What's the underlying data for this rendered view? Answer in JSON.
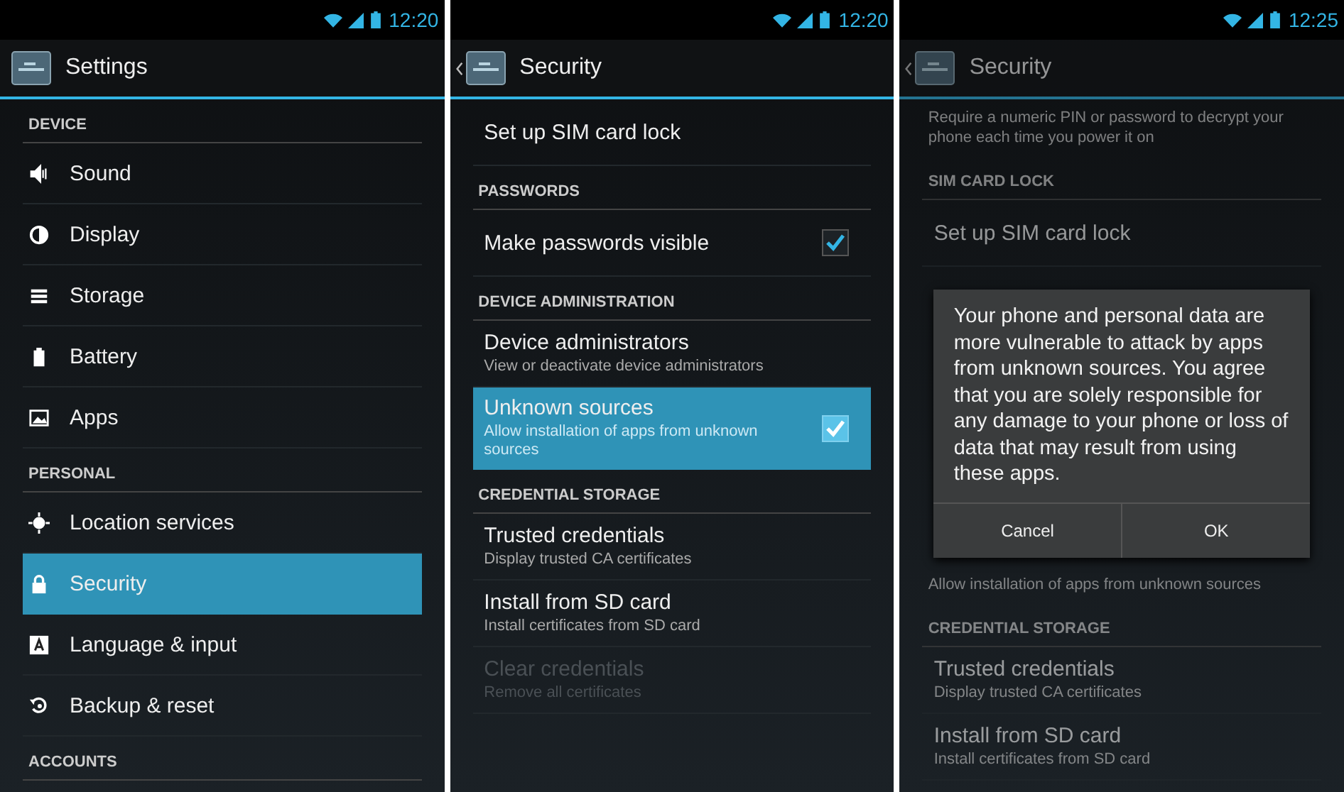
{
  "screens": [
    {
      "status_bar": {
        "time": "12:20"
      },
      "title": "Settings",
      "back": false,
      "dimmed": false,
      "list": [
        {
          "kind": "header",
          "label": "DEVICE"
        },
        {
          "kind": "nav",
          "label": "Sound",
          "selected": false
        },
        {
          "kind": "nav",
          "label": "Display",
          "selected": false
        },
        {
          "kind": "nav",
          "label": "Storage",
          "selected": false
        },
        {
          "kind": "nav",
          "label": "Battery",
          "selected": false
        },
        {
          "kind": "nav",
          "label": "Apps",
          "selected": false
        },
        {
          "kind": "header",
          "label": "PERSONAL"
        },
        {
          "kind": "nav",
          "label": "Location services",
          "selected": false
        },
        {
          "kind": "nav",
          "label": "Security",
          "selected": true
        },
        {
          "kind": "nav",
          "label": "Language & input",
          "selected": false
        },
        {
          "kind": "nav",
          "label": "Backup & reset",
          "selected": false
        },
        {
          "kind": "header",
          "label": "ACCOUNTS"
        }
      ]
    },
    {
      "status_bar": {
        "time": "12:20"
      },
      "title": "Security",
      "back": true,
      "dimmed": false,
      "list": [
        {
          "kind": "pref",
          "label": "Set up SIM card lock",
          "selected": false,
          "disabled": false
        },
        {
          "kind": "header",
          "label": "PASSWORDS"
        },
        {
          "kind": "pref",
          "label": "Make passwords visible",
          "checked": true,
          "selected": false,
          "disabled": false
        },
        {
          "kind": "header",
          "label": "DEVICE ADMINISTRATION"
        },
        {
          "kind": "pref",
          "label": "Device administrators",
          "summary": "View or deactivate device administrators",
          "selected": false,
          "disabled": false
        },
        {
          "kind": "pref",
          "label": "Unknown sources",
          "summary": "Allow installation of apps from unknown sources",
          "checked": true,
          "selected": true,
          "disabled": false
        },
        {
          "kind": "header",
          "label": "CREDENTIAL STORAGE"
        },
        {
          "kind": "pref",
          "label": "Trusted credentials",
          "summary": "Display trusted CA certificates",
          "selected": false,
          "disabled": false
        },
        {
          "kind": "pref",
          "label": "Install from SD card",
          "summary": "Install certificates from SD card",
          "selected": false,
          "disabled": false
        },
        {
          "kind": "pref",
          "label": "Clear credentials",
          "summary": "Remove all certificates",
          "selected": false,
          "disabled": true
        }
      ]
    },
    {
      "status_bar": {
        "time": "12:25"
      },
      "title": "Security",
      "back": true,
      "dimmed": true,
      "list": [
        {
          "kind": "note",
          "label": "Require a numeric PIN or password to decrypt your phone each time you power it on"
        },
        {
          "kind": "header",
          "label": "SIM CARD LOCK"
        },
        {
          "kind": "pref",
          "label": "Set up SIM card lock",
          "selected": false,
          "disabled": false
        }
      ],
      "dialog": {
        "message": "Your phone and personal data are more vulnerable to attack by apps from unknown sources. You agree that you are solely responsible for any damage to your phone or loss of data that may result from using these apps.",
        "buttons": [
          "Cancel",
          "OK"
        ]
      },
      "list_below": [
        {
          "kind": "note",
          "label": "Allow installation of apps from unknown sources"
        },
        {
          "kind": "header",
          "label": "CREDENTIAL STORAGE"
        },
        {
          "kind": "pref",
          "label": "Trusted credentials",
          "summary": "Display trusted CA certificates",
          "selected": false,
          "disabled": false
        },
        {
          "kind": "pref",
          "label": "Install from SD card",
          "summary": "Install certificates from SD card",
          "selected": false,
          "disabled": false
        }
      ]
    }
  ]
}
